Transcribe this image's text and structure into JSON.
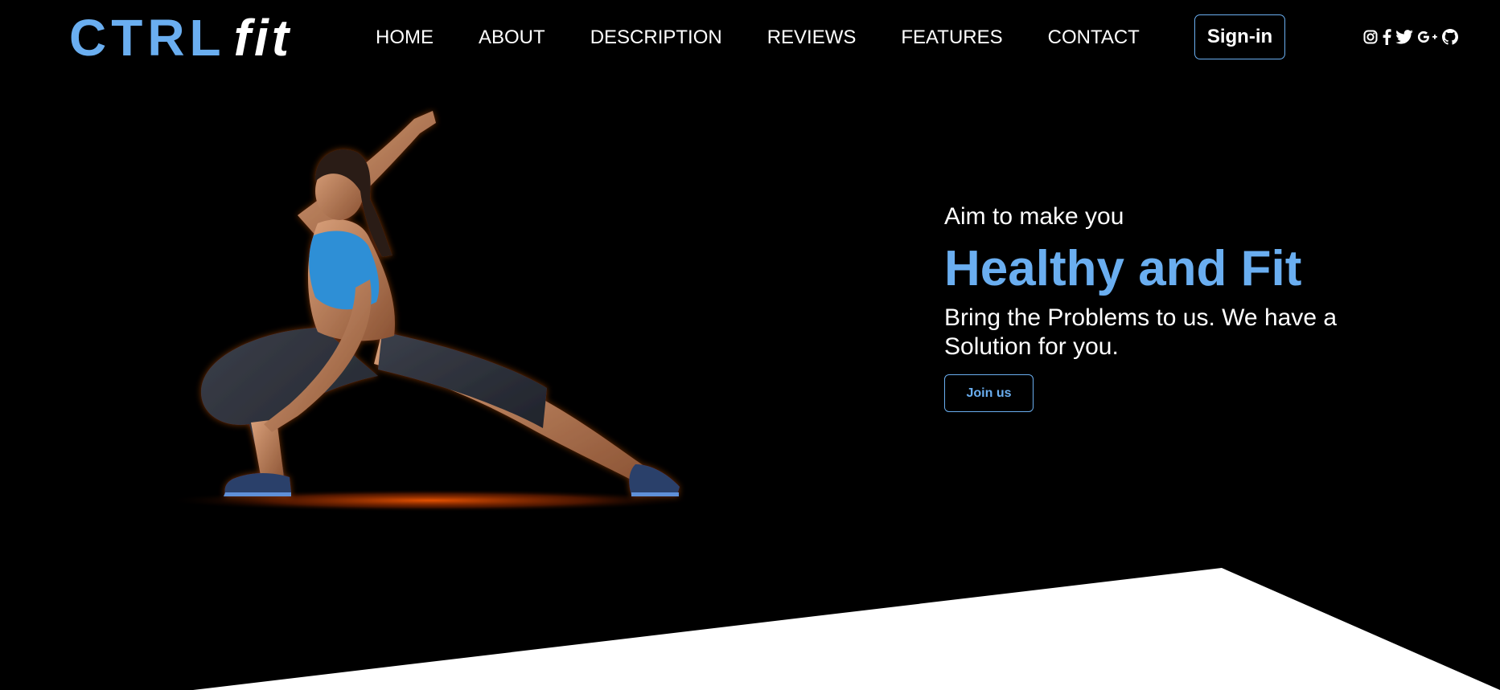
{
  "brand": {
    "logo_part1": "CTRL",
    "logo_part2": "fit"
  },
  "nav": {
    "items": [
      {
        "label": "HOME"
      },
      {
        "label": "ABOUT"
      },
      {
        "label": "DESCRIPTION"
      },
      {
        "label": "REVIEWS"
      },
      {
        "label": "FEATURES"
      },
      {
        "label": "CONTACT"
      }
    ],
    "signin_label": "Sign-in"
  },
  "social": {
    "icons": [
      "instagram-icon",
      "facebook-icon",
      "twitter-icon",
      "google-plus-icon",
      "github-icon"
    ]
  },
  "hero": {
    "tagline": "Aim to make you",
    "headline": "Healthy and Fit",
    "subtext": "Bring the Problems to us. We have a Solution for you.",
    "cta_label": "Join us"
  },
  "colors": {
    "background": "#000000",
    "accent": "#6aaef0",
    "text": "#ffffff",
    "floor_glow": "#ff5a00"
  }
}
